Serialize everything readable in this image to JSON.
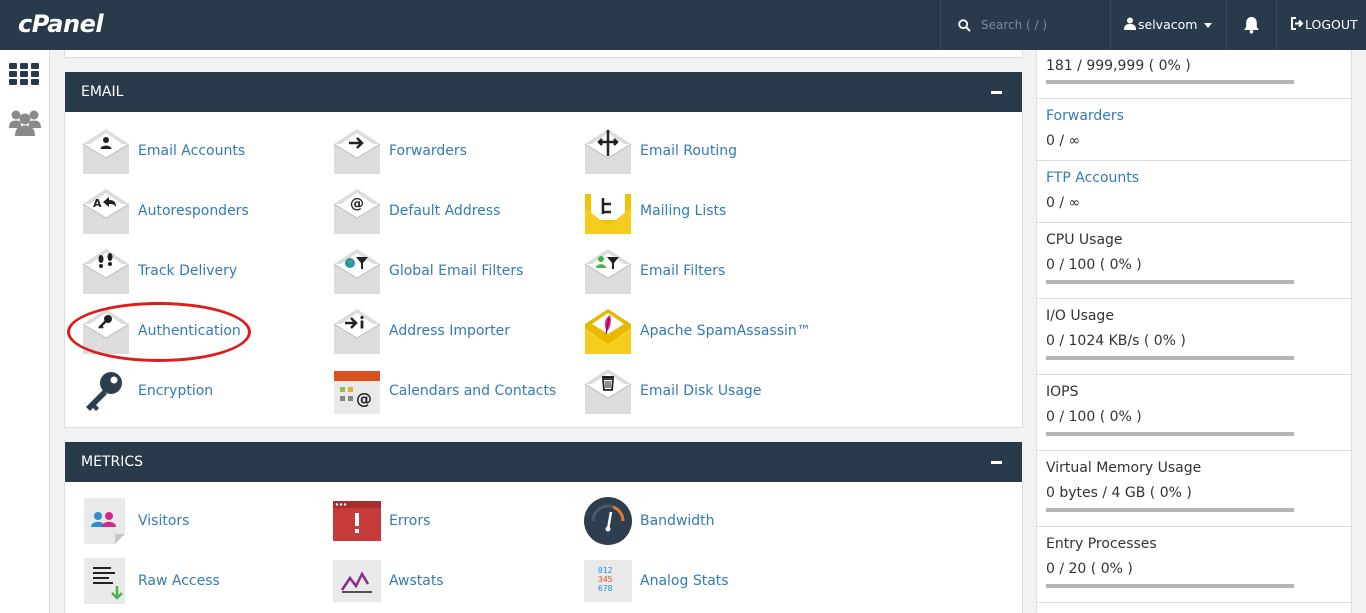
{
  "header": {
    "logo": "cPanel",
    "search_placeholder": "Search ( / )",
    "username": "selvacom",
    "logout_label": "LOGOUT"
  },
  "email": {
    "title": "EMAIL",
    "items": [
      {
        "label": "Email Accounts",
        "icon": "envelope-person-icon"
      },
      {
        "label": "Forwarders",
        "icon": "envelope-arrow-icon"
      },
      {
        "label": "Email Routing",
        "icon": "envelope-signpost-icon"
      },
      {
        "label": "Autoresponders",
        "icon": "envelope-reply-icon"
      },
      {
        "label": "Default Address",
        "icon": "envelope-at-icon"
      },
      {
        "label": "Mailing Lists",
        "icon": "yellow-envelope-list-icon"
      },
      {
        "label": "Track Delivery",
        "icon": "envelope-footprints-icon"
      },
      {
        "label": "Global Email Filters",
        "icon": "envelope-globe-filter-icon"
      },
      {
        "label": "Email Filters",
        "icon": "envelope-person-filter-icon"
      },
      {
        "label": "Authentication",
        "icon": "envelope-key-icon"
      },
      {
        "label": "Address Importer",
        "icon": "envelope-import-icon"
      },
      {
        "label": "Apache SpamAssassin™",
        "icon": "yellow-envelope-feather-icon"
      },
      {
        "label": "Encryption",
        "icon": "key-icon"
      },
      {
        "label": "Calendars and Contacts",
        "icon": "calendar-at-icon"
      },
      {
        "label": "Email Disk Usage",
        "icon": "envelope-trash-icon"
      }
    ]
  },
  "metrics": {
    "title": "METRICS",
    "items": [
      {
        "label": "Visitors",
        "icon": "visitors-page-icon"
      },
      {
        "label": "Errors",
        "icon": "error-window-icon"
      },
      {
        "label": "Bandwidth",
        "icon": "gauge-icon"
      },
      {
        "label": "Raw Access",
        "icon": "raw-access-page-icon"
      },
      {
        "label": "Awstats",
        "icon": "line-graph-icon"
      },
      {
        "label": "Analog Stats",
        "icon": "numbers-grid-icon"
      }
    ]
  },
  "stats": [
    {
      "name": "",
      "value": "181 / 999,999 ( 0% )",
      "link": false,
      "usage": 0
    },
    {
      "name": "Forwarders",
      "value": "0 / ∞",
      "link": true
    },
    {
      "name": "FTP Accounts",
      "value": "0 / ∞",
      "link": true
    },
    {
      "name": "CPU Usage",
      "value": "0 / 100 ( 0% )",
      "link": false,
      "usage": 0
    },
    {
      "name": "I/O Usage",
      "value": "0 / 1024 KB/s ( 0% )",
      "link": false,
      "usage": 0
    },
    {
      "name": "IOPS",
      "value": "0 / 100 ( 0% )",
      "link": false,
      "usage": 0
    },
    {
      "name": "Virtual Memory Usage",
      "value": "0 bytes / 4 GB ( 0% )",
      "link": false,
      "usage": 0
    },
    {
      "name": "Entry Processes",
      "value": "0 / 20 ( 0% )",
      "link": false,
      "usage": 0
    }
  ],
  "colors": {
    "header_bg": "#293a4a",
    "link": "#337ab7",
    "annotation": "#e01b1b"
  }
}
